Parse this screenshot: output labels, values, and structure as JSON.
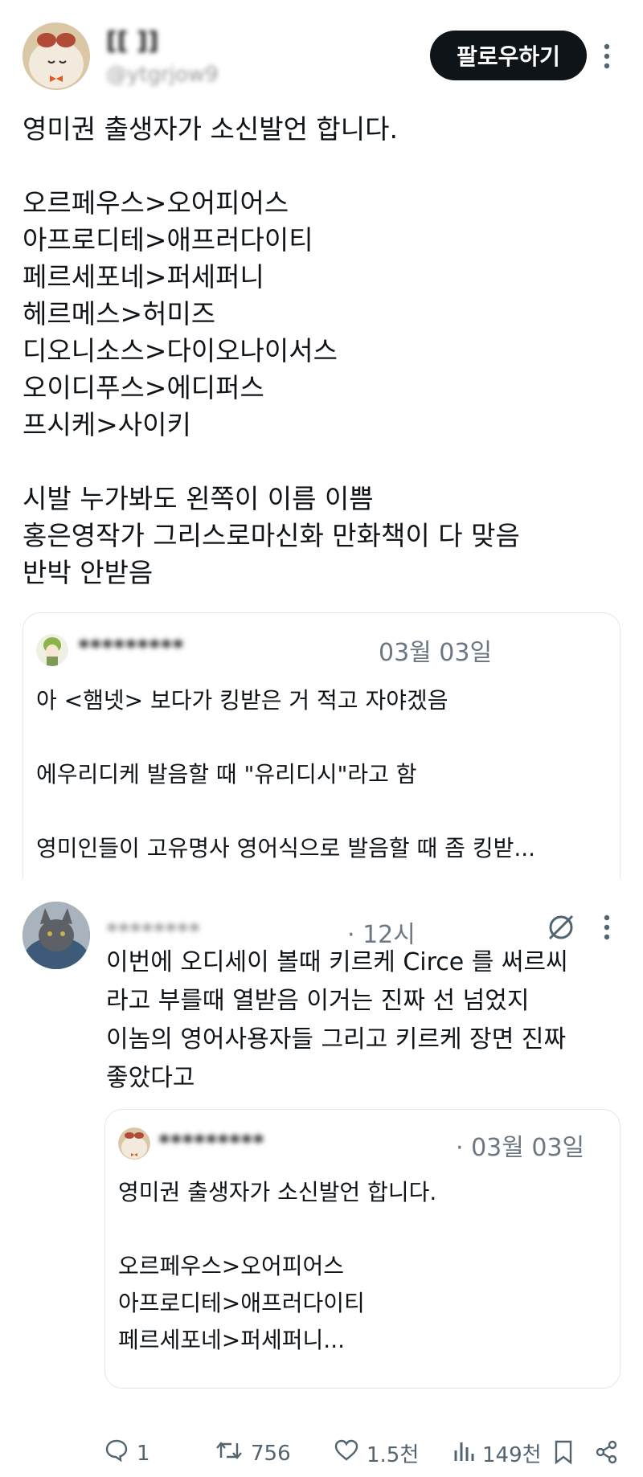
{
  "header": {
    "display_name": "[[ ]]",
    "handle": "@ytgrjow9",
    "follow_label": "팔로우하기"
  },
  "post": {
    "lines": [
      "영미권 출생자가 소신발언 합니다.",
      "",
      "오르페우스>오어피어스",
      "아프로디테>애프러다이티",
      "페르세포네>퍼세퍼니",
      "헤르메스>허미즈",
      "디오니소스>다이오나이서스",
      "오이디푸스>에디퍼스",
      "프시케>사이키",
      "",
      "시발 누가봐도 왼쪽이 이름 이쁨",
      "홍은영작가 그리스로마신화 만화책이 다 맞음",
      "반박 안받음"
    ]
  },
  "quote1": {
    "name": "*********",
    "date": "03월 03일",
    "lines": [
      "아 <햄넷> 보다가 킹받은 거 적고 자야겠음",
      "",
      "에우리디케 발음할 때 \"유리디시\"라고 함",
      "",
      "영미인들이 고유명사 영어식으로 발음할 때 좀 킹받..."
    ]
  },
  "reply": {
    "name": "********",
    "time": "· 12시",
    "lines": [
      "이번에 오디세이 볼때 키르케 Circe 를 써르씨",
      "라고 부를때 열받음 이거는 진짜 선 넘었지",
      "이놈의 영어사용자들 그리고 키르케 장면 진짜",
      "좋았다고"
    ]
  },
  "quote2": {
    "name": "*********",
    "date": "· 03월 03일",
    "lines": [
      "영미권 출생자가 소신발언 합니다.",
      "",
      "오르페우스>오어피어스",
      "아프로디테>애프러다이티",
      "페르세포네>퍼세퍼니..."
    ]
  },
  "actions": {
    "replies": "1",
    "retweets": "756",
    "likes": "1.5천",
    "views": "149천"
  },
  "icons": {
    "more": "more-vertical-icon",
    "grok": "grok-slash-icon",
    "reply": "reply-bubble-icon",
    "retweet": "retweet-icon",
    "like": "heart-icon",
    "views": "views-bar-icon",
    "bookmark": "bookmark-icon",
    "share": "share-icon"
  }
}
